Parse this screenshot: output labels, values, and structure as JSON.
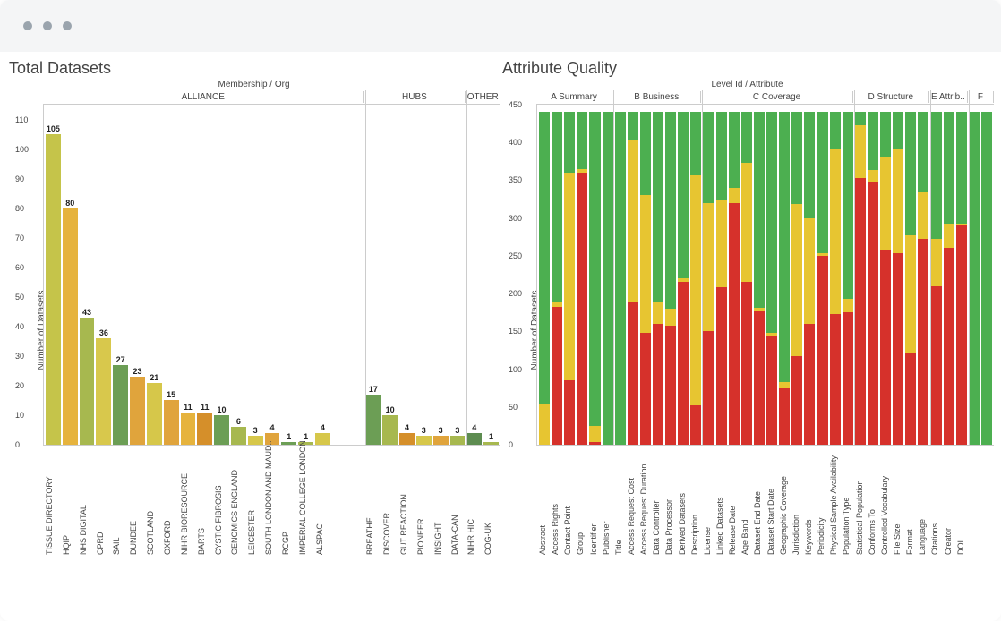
{
  "window": {
    "dots": 3
  },
  "totals": {
    "title": "Total Datasets",
    "header": "Membership / Org",
    "ylabel": "Number of Datasets",
    "ymax": 115,
    "yticks": [
      0,
      10,
      20,
      30,
      40,
      50,
      60,
      70,
      80,
      90,
      100,
      110
    ],
    "groups": [
      "ALLIANCE",
      "HUBS",
      "OTHER"
    ]
  },
  "quality": {
    "title": "Attribute Quality",
    "header": "Level Id / Attribute",
    "ylabel": "Number of Datasets",
    "ymax": 450,
    "yticks": [
      0,
      50,
      100,
      150,
      200,
      250,
      300,
      350,
      400,
      450
    ],
    "groups": [
      "A Summary",
      "B Business",
      "C Coverage",
      "D Structure",
      "E Attrib..",
      "F"
    ]
  },
  "chart_data": [
    {
      "type": "bar",
      "title": "Total Datasets",
      "xlabel": "Membership / Org",
      "ylabel": "Number of Datasets",
      "ylim": [
        0,
        115
      ],
      "legend": null,
      "grid": false,
      "groups": [
        {
          "name": "ALLIANCE",
          "span": 19
        },
        {
          "name": "HUBS",
          "span": 6
        },
        {
          "name": "OTHER",
          "span": 2
        }
      ],
      "bars": [
        {
          "label": "TISSUE DIRECTORY",
          "value": 105,
          "color": "#c5c44a",
          "group": "ALLIANCE"
        },
        {
          "label": "HQIP",
          "value": 80,
          "color": "#e6b33d",
          "group": "ALLIANCE"
        },
        {
          "label": "NHS DIGITAL",
          "value": 43,
          "color": "#a7b84f",
          "group": "ALLIANCE"
        },
        {
          "label": "CPRD",
          "value": 36,
          "color": "#d8c84c",
          "group": "ALLIANCE"
        },
        {
          "label": "SAIL",
          "value": 27,
          "color": "#6c9e55",
          "group": "ALLIANCE"
        },
        {
          "label": "DUNDEE",
          "value": 23,
          "color": "#e0a43c",
          "group": "ALLIANCE"
        },
        {
          "label": "SCOTLAND",
          "value": 21,
          "color": "#d6c74a",
          "group": "ALLIANCE"
        },
        {
          "label": "OXFORD",
          "value": 15,
          "color": "#e0a43c",
          "group": "ALLIANCE"
        },
        {
          "label": "NIHR BIORESOURCE",
          "value": 11,
          "color": "#e6b33d",
          "group": "ALLIANCE"
        },
        {
          "label": "BARTS",
          "value": 11,
          "color": "#d58f2a",
          "group": "ALLIANCE"
        },
        {
          "label": "CYSTIC FIBROSIS",
          "value": 10,
          "color": "#6c9e55",
          "group": "ALLIANCE"
        },
        {
          "label": "GENOMICS ENGLAND",
          "value": 6,
          "color": "#a7b84f",
          "group": "ALLIANCE"
        },
        {
          "label": "LEICESTER",
          "value": 3,
          "color": "#d6c74a",
          "group": "ALLIANCE"
        },
        {
          "label": "SOUTH LONDON AND MAUD..",
          "value": 4,
          "color": "#e0a43c",
          "group": "ALLIANCE"
        },
        {
          "label": "RCGP",
          "value": 1,
          "color": "#6c9e55",
          "group": "ALLIANCE"
        },
        {
          "label": "IMPERIAL COLLEGE LONDON",
          "value": 1,
          "color": "#a7b84f",
          "group": "ALLIANCE"
        },
        {
          "label": "ALSPAC",
          "value": 4,
          "color": "#d6c74a",
          "group": "ALLIANCE"
        },
        {
          "label": "",
          "value": 0,
          "color": "#ffffff",
          "group": "ALLIANCE"
        },
        {
          "label": "",
          "value": 0,
          "color": "#ffffff",
          "group": "ALLIANCE"
        },
        {
          "label": "BREATHE",
          "value": 17,
          "color": "#6c9e55",
          "group": "HUBS"
        },
        {
          "label": "DISCOVER",
          "value": 10,
          "color": "#a7b84f",
          "group": "HUBS"
        },
        {
          "label": "GUT REACTION",
          "value": 4,
          "color": "#d58f2a",
          "group": "HUBS"
        },
        {
          "label": "PIONEER",
          "value": 3,
          "color": "#d6c74a",
          "group": "HUBS"
        },
        {
          "label": "INSIGHT",
          "value": 3,
          "color": "#e0a43c",
          "group": "HUBS"
        },
        {
          "label": "DATA-CAN",
          "value": 3,
          "color": "#a7b84f",
          "group": "HUBS"
        },
        {
          "label": "NIHR HIC",
          "value": 4,
          "color": "#5d8c50",
          "group": "OTHER"
        },
        {
          "label": "COG-UK",
          "value": 1,
          "color": "#a7b84f",
          "group": "OTHER"
        }
      ]
    },
    {
      "type": "bar",
      "stacked": true,
      "title": "Attribute Quality",
      "xlabel": "Level Id / Attribute",
      "ylabel": "Number of Datasets",
      "ylim": [
        0,
        450
      ],
      "series_names": [
        "red",
        "yellow",
        "green"
      ],
      "total": 440,
      "groups": [
        {
          "name": "A Summary",
          "span": 6
        },
        {
          "name": "B Business",
          "span": 7
        },
        {
          "name": "C Coverage",
          "span": 12
        },
        {
          "name": "D Structure",
          "span": 6
        },
        {
          "name": "E Attrib..",
          "span": 3
        },
        {
          "name": "F",
          "span": 2
        }
      ],
      "bars": [
        {
          "label": "Abstract",
          "red": 0,
          "yellow": 55,
          "group": "A Summary"
        },
        {
          "label": "Access Rights",
          "red": 182,
          "yellow": 8,
          "group": "A Summary"
        },
        {
          "label": "Contact Point",
          "red": 85,
          "yellow": 275,
          "group": "A Summary"
        },
        {
          "label": "Group",
          "red": 360,
          "yellow": 5,
          "group": "A Summary"
        },
        {
          "label": "Identifier",
          "red": 3,
          "yellow": 22,
          "group": "A Summary"
        },
        {
          "label": "Publisher",
          "red": 0,
          "yellow": 0,
          "group": "A Summary"
        },
        {
          "label": "Title",
          "red": 0,
          "yellow": 0,
          "group": "B Business"
        },
        {
          "label": "Access Request Cost",
          "red": 188,
          "yellow": 215,
          "group": "B Business"
        },
        {
          "label": "Access Request Duration",
          "red": 148,
          "yellow": 182,
          "group": "B Business"
        },
        {
          "label": "Data Controller",
          "red": 160,
          "yellow": 28,
          "group": "B Business"
        },
        {
          "label": "Data Processor",
          "red": 158,
          "yellow": 22,
          "group": "B Business"
        },
        {
          "label": "Derived Datasets",
          "red": 215,
          "yellow": 5,
          "group": "B Business"
        },
        {
          "label": "Description",
          "red": 52,
          "yellow": 305,
          "group": "B Business"
        },
        {
          "label": "License",
          "red": 150,
          "yellow": 170,
          "group": "C Coverage"
        },
        {
          "label": "Linked Datasets",
          "red": 208,
          "yellow": 115,
          "group": "C Coverage"
        },
        {
          "label": "Release Date",
          "red": 320,
          "yellow": 20,
          "group": "C Coverage"
        },
        {
          "label": "Age Band",
          "red": 215,
          "yellow": 158,
          "group": "C Coverage"
        },
        {
          "label": "Dataset End Date",
          "red": 178,
          "yellow": 3,
          "group": "C Coverage"
        },
        {
          "label": "Dataset Start Date",
          "red": 145,
          "yellow": 3,
          "group": "C Coverage"
        },
        {
          "label": "Geographic Coverage",
          "red": 75,
          "yellow": 8,
          "group": "C Coverage"
        },
        {
          "label": "Jurisdiction",
          "red": 117,
          "yellow": 202,
          "group": "C Coverage"
        },
        {
          "label": "Keywords",
          "red": 160,
          "yellow": 140,
          "group": "C Coverage"
        },
        {
          "label": "Periodicity",
          "red": 250,
          "yellow": 3,
          "group": "C Coverage"
        },
        {
          "label": "Physical Sample Availability",
          "red": 173,
          "yellow": 218,
          "group": "C Coverage"
        },
        {
          "label": "Population Type",
          "red": 175,
          "yellow": 18,
          "group": "C Coverage"
        },
        {
          "label": "Statistical Population",
          "red": 353,
          "yellow": 70,
          "group": "D Structure"
        },
        {
          "label": "Conforms To",
          "red": 348,
          "yellow": 15,
          "group": "D Structure"
        },
        {
          "label": "Controlled Vocabulary",
          "red": 258,
          "yellow": 122,
          "group": "D Structure"
        },
        {
          "label": "File Size",
          "red": 253,
          "yellow": 138,
          "group": "D Structure"
        },
        {
          "label": "Format",
          "red": 122,
          "yellow": 155,
          "group": "D Structure"
        },
        {
          "label": "Language",
          "red": 272,
          "yellow": 62,
          "group": "D Structure"
        },
        {
          "label": "Citations",
          "red": 210,
          "yellow": 62,
          "group": "E Attrib.."
        },
        {
          "label": "Creator",
          "red": 260,
          "yellow": 32,
          "group": "E Attrib.."
        },
        {
          "label": "DOI",
          "red": 290,
          "yellow": 2,
          "group": "E Attrib.."
        },
        {
          "label": "",
          "red": 0,
          "yellow": 0,
          "group": "F"
        },
        {
          "label": "",
          "red": 0,
          "yellow": 0,
          "group": "F"
        }
      ]
    }
  ]
}
